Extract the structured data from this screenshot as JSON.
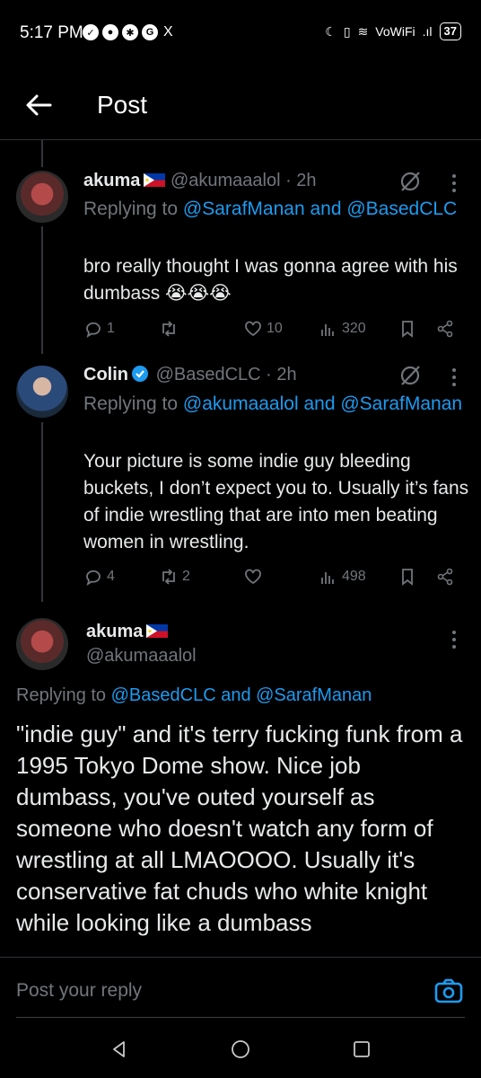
{
  "status_bar": {
    "time": "5:17 PM",
    "notifications": [
      "G",
      "X"
    ],
    "network": "VoWiFi",
    "battery": "37"
  },
  "header": {
    "title": "Post"
  },
  "replies": [
    {
      "name": "akuma",
      "handle": "@akumaaalol",
      "time": "· 2h",
      "replying_prefix": "Replying to",
      "replying_to": "@SarafManan and @BasedCLC",
      "text": "bro really thought I was gonna agree with his dumbass 😭😭😭",
      "stats": {
        "replies": "1",
        "reposts": "",
        "likes": "10",
        "views": "320"
      }
    },
    {
      "name": "Colin",
      "handle": "@BasedCLC",
      "time": "· 2h",
      "replying_prefix": "Replying to",
      "replying_to": "@akumaaalol and @SarafManan",
      "text": "Your picture is some indie guy bleeding buckets, I don’t expect you to. Usually it’s fans of indie wrestling that are into men beating women in wrestling.",
      "stats": {
        "replies": "4",
        "reposts": "2",
        "likes": "",
        "views": "498"
      }
    }
  ],
  "main_post": {
    "name": "akuma",
    "handle": "@akumaaalol",
    "replying_prefix": "Replying to",
    "replying_to": "@BasedCLC and @SarafManan",
    "text": "\"indie guy\" and it's terry fucking funk from a 1995 Tokyo Dome show. Nice job dumbass, you've outed yourself as someone who doesn't watch any form of wrestling at all LMAOOOO. Usually it's conservative fat chuds who white knight while looking like a dumbass"
  },
  "reply_bar": {
    "placeholder": "Post your reply"
  },
  "colors": {
    "accent": "#1d9bf0",
    "muted": "#71767b",
    "background": "#000000"
  }
}
